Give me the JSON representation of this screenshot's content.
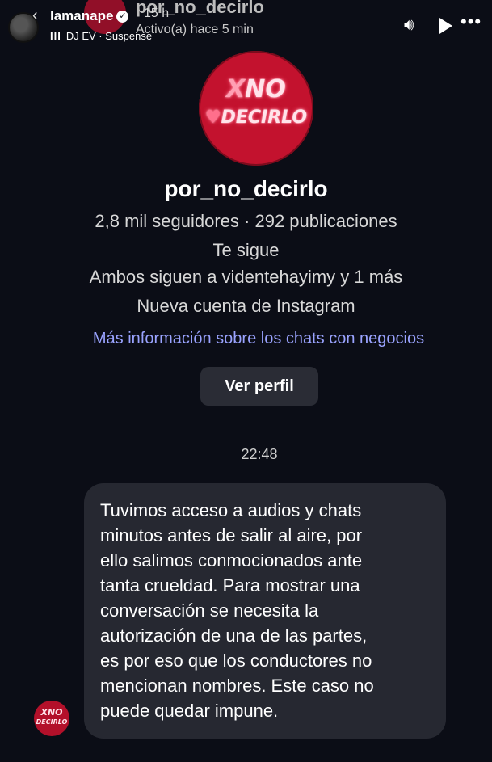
{
  "story": {
    "username": "lamanape",
    "verified_glyph": "✓",
    "time": "15 h",
    "music_icon": "III",
    "music": "DJ EV · Suspense",
    "controls": [
      "sound-icon",
      "play-icon",
      "more-icon"
    ]
  },
  "chat_header": {
    "name": "por_no_decirlo",
    "status": "Activo(a) hace 5 min"
  },
  "profile": {
    "logo_top_x": "X",
    "logo_top_rest": "NO",
    "logo_heart": "♥",
    "logo_bottom": "DECIRLO",
    "name": "por_no_decirlo",
    "stats": "2,8 mil seguidores · 292 publicaciones",
    "follows_you": "Te sigue",
    "mutual": "Ambos siguen a videntehayimy y 1 más",
    "new_account": "Nueva cuenta de Instagram",
    "business_link": "Más información sobre los chats con negocios",
    "view_profile_button": "Ver perfil"
  },
  "messages": [
    {
      "timestamp": "22:48",
      "avatar_top": "XNO",
      "avatar_bottom": "DECIRLO",
      "lines": [
        "Tuvimos acceso a audios y chats",
        "minutos antes de salir al aire, por",
        "ello salimos conmocionados ante",
        "tanta crueldad. Para mostrar una",
        "conversación se necesita la",
        "autorización de una de las partes,",
        "es por eso que los conductores no",
        "mencionan nombres. Este caso no",
        "puede quedar impune."
      ]
    }
  ],
  "colors": {
    "background": "#0b0d16",
    "bubble": "#262831",
    "link": "#9aa3ff",
    "brand": "#c3122e"
  }
}
